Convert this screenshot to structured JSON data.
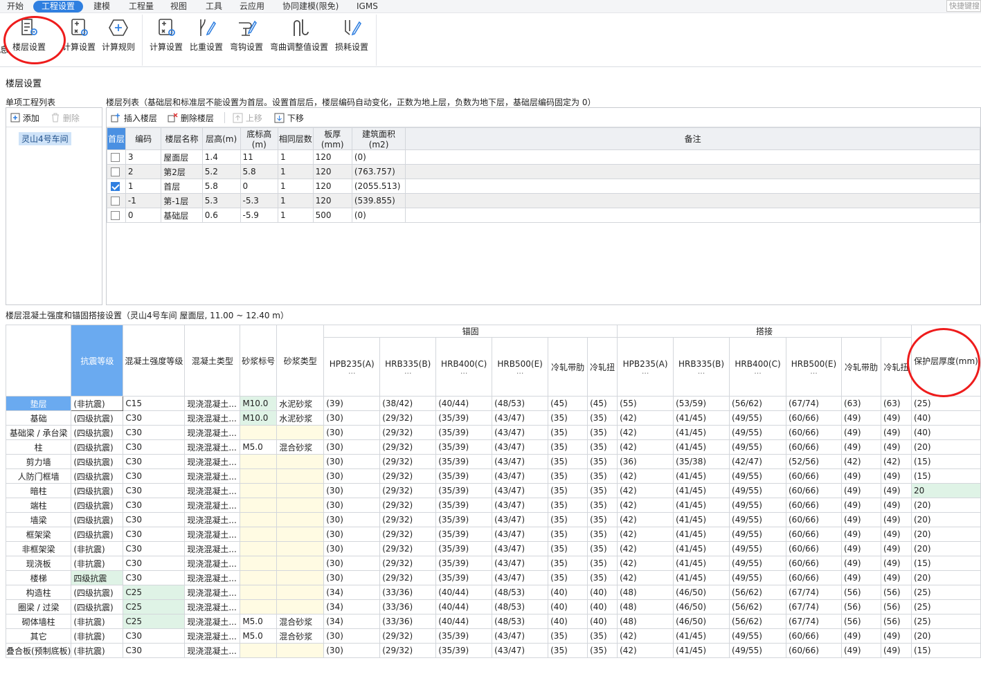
{
  "menubar": {
    "items": [
      "开始",
      "工程设置",
      "建模",
      "工程量",
      "视图",
      "工具",
      "云应用",
      "协同建模(限免)",
      "IGMS"
    ],
    "active_index": 1,
    "quick_search": "快捷键搜"
  },
  "ribbon": {
    "partial_left": "息",
    "buttons": [
      {
        "label": "楼层设置",
        "icon": "floor-settings-icon"
      },
      {
        "label": "计算设置",
        "icon": "calc-settings-icon"
      },
      {
        "label": "计算规则",
        "icon": "calc-rules-icon"
      },
      {
        "label": "计算设置",
        "icon": "calc-settings-icon"
      },
      {
        "label": "比重设置",
        "icon": "weight-settings-icon"
      },
      {
        "label": "弯钩设置",
        "icon": "hook-settings-icon"
      },
      {
        "label": "弯曲调整值设置",
        "icon": "bend-adjust-icon"
      },
      {
        "label": "损耗设置",
        "icon": "loss-settings-icon"
      }
    ]
  },
  "dialog": {
    "title": "楼层设置",
    "left": {
      "header": "单项工程列表",
      "add_label": "添加",
      "delete_label": "删除",
      "selected_item": "灵山4号车间"
    },
    "floors": {
      "header": "楼层列表（基础层和标准层不能设置为首层。设置首层后，楼层编码自动变化，正数为地上层，负数为地下层，基础层编码固定为 0）",
      "toolbar": {
        "insert": "插入楼层",
        "delete": "删除楼层",
        "up": "上移",
        "down": "下移"
      },
      "columns": [
        "首层",
        "编码",
        "楼层名称",
        "层高(m)",
        "底标高(m)",
        "相同层数",
        "板厚(mm)",
        "建筑面积(m2)",
        "备注"
      ],
      "rows": [
        {
          "first": false,
          "code": "3",
          "name": "屋面层",
          "height": "1.4",
          "base": "11",
          "same": "1",
          "thick": "120",
          "area": "(0)",
          "note": ""
        },
        {
          "first": false,
          "code": "2",
          "name": "第2层",
          "height": "5.2",
          "base": "5.8",
          "same": "1",
          "thick": "120",
          "area": "(763.757)",
          "note": ""
        },
        {
          "first": true,
          "code": "1",
          "name": "首层",
          "height": "5.8",
          "base": "0",
          "same": "1",
          "thick": "120",
          "area": "(2055.513)",
          "note": ""
        },
        {
          "first": false,
          "code": "-1",
          "name": "第-1层",
          "height": "5.3",
          "base": "-5.3",
          "same": "1",
          "thick": "120",
          "area": "(539.855)",
          "note": ""
        },
        {
          "first": false,
          "code": "0",
          "name": "基础层",
          "height": "0.6",
          "base": "-5.9",
          "same": "1",
          "thick": "500",
          "area": "(0)",
          "note": ""
        }
      ]
    },
    "concrete": {
      "header": "楼层混凝土强度和锚固搭接设置（灵山4号车间  屋面层, 11.00 ~ 12.40 m）",
      "group_anchor": "锚固",
      "group_lap": "搭接",
      "col_seismic": "抗震等级",
      "col_strength": "混凝土强度等级",
      "col_type": "混凝土类型",
      "col_mortar_grade": "砂浆标号",
      "col_mortar_type": "砂浆类型",
      "steel_cols": [
        "HPB235(A)",
        "HRB335(B)",
        "HRB400(C)",
        "HRB500(E)",
        "冷轧带肋",
        "冷轧扭"
      ],
      "steel_sub": "...",
      "col_cover": "保护层厚度(mm)",
      "rows": [
        {
          "name": "垫层",
          "seismic": "(非抗震)",
          "strength": "C15",
          "ctype": "现浇混凝土...",
          "mgrade": "M10.0",
          "mtype": "水泥砂浆",
          "anchor": [
            "(39)",
            "(38/42)",
            "(40/44)",
            "(48/53)",
            "(45)",
            "(45)"
          ],
          "lap": [
            "(55)",
            "(53/59)",
            "(56/62)",
            "(67/74)",
            "(63)",
            "(63)"
          ],
          "cover": "(25)"
        },
        {
          "name": "基础",
          "seismic": "(四级抗震)",
          "strength": "C30",
          "ctype": "现浇混凝土...",
          "mgrade": "M10.0",
          "mtype": "水泥砂浆",
          "anchor": [
            "(30)",
            "(29/32)",
            "(35/39)",
            "(43/47)",
            "(35)",
            "(35)"
          ],
          "lap": [
            "(42)",
            "(41/45)",
            "(49/55)",
            "(60/66)",
            "(49)",
            "(49)"
          ],
          "cover": "(40)"
        },
        {
          "name": "基础梁 / 承台梁",
          "seismic": "(四级抗震)",
          "strength": "C30",
          "ctype": "现浇混凝土...",
          "mgrade": "",
          "mtype": "",
          "anchor": [
            "(30)",
            "(29/32)",
            "(35/39)",
            "(43/47)",
            "(35)",
            "(35)"
          ],
          "lap": [
            "(42)",
            "(41/45)",
            "(49/55)",
            "(60/66)",
            "(49)",
            "(49)"
          ],
          "cover": "(40)"
        },
        {
          "name": "柱",
          "seismic": "(四级抗震)",
          "strength": "C30",
          "ctype": "现浇混凝土...",
          "mgrade": "M5.0",
          "mtype": "混合砂浆",
          "anchor": [
            "(30)",
            "(29/32)",
            "(35/39)",
            "(43/47)",
            "(35)",
            "(35)"
          ],
          "lap": [
            "(42)",
            "(41/45)",
            "(49/55)",
            "(60/66)",
            "(49)",
            "(49)"
          ],
          "cover": "(20)"
        },
        {
          "name": "剪力墙",
          "seismic": "(四级抗震)",
          "strength": "C30",
          "ctype": "现浇混凝土...",
          "mgrade": "",
          "mtype": "",
          "anchor": [
            "(30)",
            "(29/32)",
            "(35/39)",
            "(43/47)",
            "(35)",
            "(35)"
          ],
          "lap": [
            "(36)",
            "(35/38)",
            "(42/47)",
            "(52/56)",
            "(42)",
            "(42)"
          ],
          "cover": "(15)"
        },
        {
          "name": "人防门框墙",
          "seismic": "(四级抗震)",
          "strength": "C30",
          "ctype": "现浇混凝土...",
          "mgrade": "",
          "mtype": "",
          "anchor": [
            "(30)",
            "(29/32)",
            "(35/39)",
            "(43/47)",
            "(35)",
            "(35)"
          ],
          "lap": [
            "(42)",
            "(41/45)",
            "(49/55)",
            "(60/66)",
            "(49)",
            "(49)"
          ],
          "cover": "(15)"
        },
        {
          "name": "暗柱",
          "seismic": "(四级抗震)",
          "strength": "C30",
          "ctype": "现浇混凝土...",
          "mgrade": "",
          "mtype": "",
          "anchor": [
            "(30)",
            "(29/32)",
            "(35/39)",
            "(43/47)",
            "(35)",
            "(35)"
          ],
          "lap": [
            "(42)",
            "(41/45)",
            "(49/55)",
            "(60/66)",
            "(49)",
            "(49)"
          ],
          "cover": "20"
        },
        {
          "name": "端柱",
          "seismic": "(四级抗震)",
          "strength": "C30",
          "ctype": "现浇混凝土...",
          "mgrade": "",
          "mtype": "",
          "anchor": [
            "(30)",
            "(29/32)",
            "(35/39)",
            "(43/47)",
            "(35)",
            "(35)"
          ],
          "lap": [
            "(42)",
            "(41/45)",
            "(49/55)",
            "(60/66)",
            "(49)",
            "(49)"
          ],
          "cover": "(20)"
        },
        {
          "name": "墙梁",
          "seismic": "(四级抗震)",
          "strength": "C30",
          "ctype": "现浇混凝土...",
          "mgrade": "",
          "mtype": "",
          "anchor": [
            "(30)",
            "(29/32)",
            "(35/39)",
            "(43/47)",
            "(35)",
            "(35)"
          ],
          "lap": [
            "(42)",
            "(41/45)",
            "(49/55)",
            "(60/66)",
            "(49)",
            "(49)"
          ],
          "cover": "(20)"
        },
        {
          "name": "框架梁",
          "seismic": "(四级抗震)",
          "strength": "C30",
          "ctype": "现浇混凝土...",
          "mgrade": "",
          "mtype": "",
          "anchor": [
            "(30)",
            "(29/32)",
            "(35/39)",
            "(43/47)",
            "(35)",
            "(35)"
          ],
          "lap": [
            "(42)",
            "(41/45)",
            "(49/55)",
            "(60/66)",
            "(49)",
            "(49)"
          ],
          "cover": "(20)"
        },
        {
          "name": "非框架梁",
          "seismic": "(非抗震)",
          "strength": "C30",
          "ctype": "现浇混凝土...",
          "mgrade": "",
          "mtype": "",
          "anchor": [
            "(30)",
            "(29/32)",
            "(35/39)",
            "(43/47)",
            "(35)",
            "(35)"
          ],
          "lap": [
            "(42)",
            "(41/45)",
            "(49/55)",
            "(60/66)",
            "(49)",
            "(49)"
          ],
          "cover": "(20)"
        },
        {
          "name": "现浇板",
          "seismic": "(非抗震)",
          "strength": "C30",
          "ctype": "现浇混凝土...",
          "mgrade": "",
          "mtype": "",
          "anchor": [
            "(30)",
            "(29/32)",
            "(35/39)",
            "(43/47)",
            "(35)",
            "(35)"
          ],
          "lap": [
            "(42)",
            "(41/45)",
            "(49/55)",
            "(60/66)",
            "(49)",
            "(49)"
          ],
          "cover": "(15)"
        },
        {
          "name": "楼梯",
          "seismic": "四级抗震",
          "strength": "C30",
          "ctype": "现浇混凝土...",
          "mgrade": "",
          "mtype": "",
          "anchor": [
            "(30)",
            "(29/32)",
            "(35/39)",
            "(43/47)",
            "(35)",
            "(35)"
          ],
          "lap": [
            "(42)",
            "(41/45)",
            "(49/55)",
            "(60/66)",
            "(49)",
            "(49)"
          ],
          "cover": "(20)"
        },
        {
          "name": "构造柱",
          "seismic": "(四级抗震)",
          "strength": "C25",
          "ctype": "现浇混凝土...",
          "mgrade": "",
          "mtype": "",
          "anchor": [
            "(34)",
            "(33/36)",
            "(40/44)",
            "(48/53)",
            "(40)",
            "(40)"
          ],
          "lap": [
            "(48)",
            "(46/50)",
            "(56/62)",
            "(67/74)",
            "(56)",
            "(56)"
          ],
          "cover": "(25)"
        },
        {
          "name": "圈梁 / 过梁",
          "seismic": "(四级抗震)",
          "strength": "C25",
          "ctype": "现浇混凝土...",
          "mgrade": "",
          "mtype": "",
          "anchor": [
            "(34)",
            "(33/36)",
            "(40/44)",
            "(48/53)",
            "(40)",
            "(40)"
          ],
          "lap": [
            "(48)",
            "(46/50)",
            "(56/62)",
            "(67/74)",
            "(56)",
            "(56)"
          ],
          "cover": "(25)"
        },
        {
          "name": "砌体墙柱",
          "seismic": "(非抗震)",
          "strength": "C25",
          "ctype": "现浇混凝土...",
          "mgrade": "M5.0",
          "mtype": "混合砂浆",
          "anchor": [
            "(34)",
            "(33/36)",
            "(40/44)",
            "(48/53)",
            "(40)",
            "(40)"
          ],
          "lap": [
            "(48)",
            "(46/50)",
            "(56/62)",
            "(67/74)",
            "(56)",
            "(56)"
          ],
          "cover": "(25)"
        },
        {
          "name": "其它",
          "seismic": "(非抗震)",
          "strength": "C30",
          "ctype": "现浇混凝土...",
          "mgrade": "M5.0",
          "mtype": "混合砂浆",
          "anchor": [
            "(30)",
            "(29/32)",
            "(35/39)",
            "(43/47)",
            "(35)",
            "(35)"
          ],
          "lap": [
            "(42)",
            "(41/45)",
            "(49/55)",
            "(60/66)",
            "(49)",
            "(49)"
          ],
          "cover": "(20)"
        },
        {
          "name": "叠合板(预制底板)",
          "seismic": "(非抗震)",
          "strength": "C30",
          "ctype": "现浇混凝土...",
          "mgrade": "",
          "mtype": "",
          "anchor": [
            "(30)",
            "(29/32)",
            "(35/39)",
            "(43/47)",
            "(35)",
            "(35)"
          ],
          "lap": [
            "(42)",
            "(41/45)",
            "(49/55)",
            "(60/66)",
            "(49)",
            "(49)"
          ],
          "cover": "(15)"
        }
      ]
    }
  },
  "colors": {
    "accent": "#2f7fe0",
    "selected_header": "#6aaaf0",
    "highlight_circle": "#ee1c1c"
  }
}
